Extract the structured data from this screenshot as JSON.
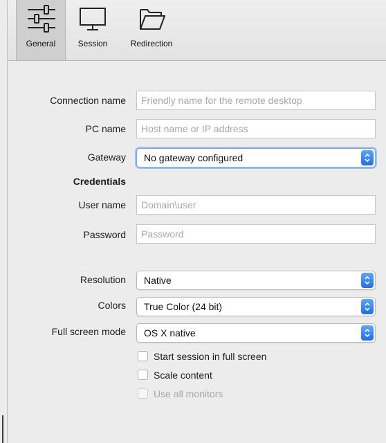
{
  "toolbar": {
    "tabs": [
      {
        "label": "General",
        "icon": "sliders-icon"
      },
      {
        "label": "Session",
        "icon": "monitor-icon"
      },
      {
        "label": "Redirection",
        "icon": "folder-icon"
      }
    ]
  },
  "form": {
    "connection_name": {
      "label": "Connection name",
      "value": "",
      "placeholder": "Friendly name for the remote desktop"
    },
    "pc_name": {
      "label": "PC name",
      "value": "",
      "placeholder": "Host name or IP address"
    },
    "gateway": {
      "label": "Gateway",
      "value": "No gateway configured"
    },
    "credentials_heading": "Credentials",
    "user_name": {
      "label": "User name",
      "value": "",
      "placeholder": "Domain\\user"
    },
    "password": {
      "label": "Password",
      "value": "",
      "placeholder": "Password"
    },
    "resolution": {
      "label": "Resolution",
      "value": "Native"
    },
    "colors": {
      "label": "Colors",
      "value": "True Color (24 bit)"
    },
    "full_screen_mode": {
      "label": "Full screen mode",
      "value": "OS X native"
    },
    "checkboxes": [
      {
        "label": "Start session in full screen",
        "checked": false,
        "enabled": true
      },
      {
        "label": "Scale content",
        "checked": false,
        "enabled": true
      },
      {
        "label": "Use all monitors",
        "checked": false,
        "enabled": false
      }
    ]
  },
  "colors": {
    "accent": "#1f6fe7",
    "focus_ring": "#9cc2f3",
    "window_bg": "#ececec"
  }
}
